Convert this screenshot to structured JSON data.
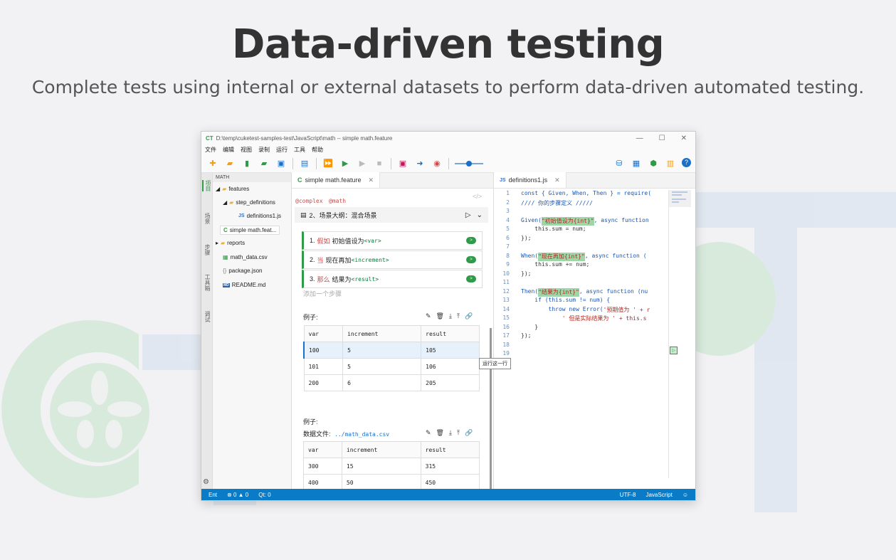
{
  "hero": {
    "title": "Data-driven testing",
    "subtitle": "Complete tests using internal or external datasets to perform data-driven automated testing."
  },
  "window": {
    "logo": "CT",
    "title": "D:\\temp\\cuketest-samples-test\\JavaScript\\math -- simple math.feature",
    "controls": [
      "—",
      "☐",
      "✕"
    ]
  },
  "menu": [
    "文件",
    "编辑",
    "视图",
    "录制",
    "运行",
    "工具",
    "帮助"
  ],
  "activity_tabs": [
    "项目",
    "场景",
    "步骤",
    "工具箱",
    "调试"
  ],
  "explorer": {
    "header": "MATH",
    "items": [
      {
        "label": "features",
        "icon": "folder-icon"
      },
      {
        "label": "step_definitions",
        "icon": "folder-icon"
      },
      {
        "label": "definitions1.js",
        "icon": "js-file-icon"
      },
      {
        "label": "simple math.feat...",
        "icon": "feature-file-icon"
      },
      {
        "label": "reports",
        "icon": "folder-icon"
      },
      {
        "label": "math_data.csv",
        "icon": "csv-file-icon"
      },
      {
        "label": "package.json",
        "icon": "json-file-icon"
      },
      {
        "label": "README.md",
        "icon": "markdown-file-icon"
      }
    ]
  },
  "feature_tab": {
    "icon": "C",
    "label": "simple math.feature"
  },
  "code_tab": {
    "icon": "JS",
    "label": "definitions1.js"
  },
  "feature": {
    "tags": [
      "@complex",
      "@math"
    ],
    "scenario_title": "2、场景大纲：混合场景",
    "steps": [
      {
        "num": "1.",
        "kw": "假如",
        "text": "初始值设为",
        "param": "<var>"
      },
      {
        "num": "2.",
        "kw": "当",
        "text": "现在再加",
        "param": "<increment>"
      },
      {
        "num": "3.",
        "kw": "那么",
        "text": "结果为",
        "param": "<result>"
      }
    ],
    "add_step": "添加一个步骤",
    "examples1": {
      "label": "例子:",
      "headers": [
        "var",
        "increment",
        "result"
      ],
      "rows": [
        [
          "100",
          "5",
          "105"
        ],
        [
          "101",
          "5",
          "106"
        ],
        [
          "200",
          "6",
          "205"
        ]
      ]
    },
    "tooltip": "运行这一行",
    "examples2": {
      "label": "例子:",
      "file_label": "数据文件:",
      "file_path": "../math_data.csv",
      "headers": [
        "var",
        "increment",
        "result"
      ],
      "rows": [
        [
          "300",
          "15",
          "315"
        ],
        [
          "400",
          "50",
          "450"
        ]
      ]
    }
  },
  "code": {
    "line_numbers": [
      "1",
      "2",
      "3",
      "4",
      "5",
      "6",
      "7",
      "8",
      "9",
      "10",
      "11",
      "12",
      "13",
      "14",
      "15",
      "16",
      "17",
      "18",
      "19"
    ],
    "l1a": "const { Given, When, Then } = require(",
    "l2": "//// 你的步骤定义 /////",
    "l4a": "Given(",
    "l4s": "\"初始值设为{int}\"",
    "l4b": ", async function",
    "l5": "    this.sum = num;",
    "l6": "});",
    "l8a": "When(",
    "l8s": "\"现在再加{int}\"",
    "l8b": ", async function (",
    "l9": "    this.sum += num;",
    "l10": "});",
    "l12a": "Then(",
    "l12s": "\"结果为{int}\"",
    "l12b": ", async function (nu",
    "l13": "    if (this.sum != num) {",
    "l14a": "        throw new Error(",
    "l14s": "'预期值为 ' + r",
    "l15a": "            ' 但是实际结果为 ' + this.s",
    "l16": "    }",
    "l17": "});"
  },
  "status": {
    "left1": "Ent",
    "errors": "0",
    "warnings": "0",
    "qt": "Qt: 0",
    "encoding": "UTF-8",
    "language": "JavaScript"
  },
  "colors": {
    "accent": "#2e9b48",
    "status_bar": "#0a7bc7"
  }
}
